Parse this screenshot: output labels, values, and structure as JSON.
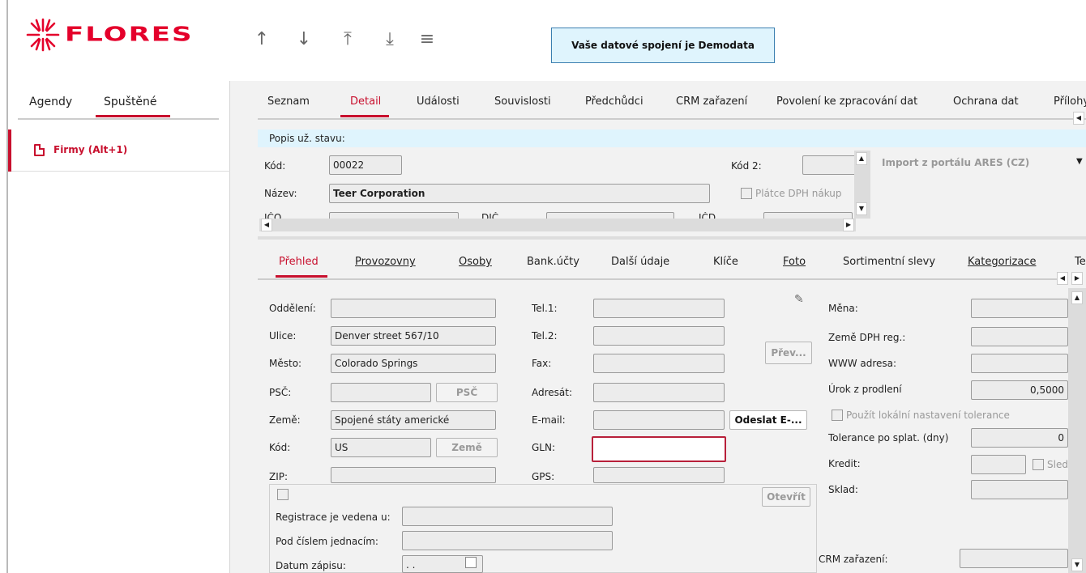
{
  "header": {
    "logo_text": "FLORES",
    "nav_icons": [
      "arrow-up-icon",
      "arrow-down-icon",
      "arrow-to-top-icon",
      "arrow-to-bottom-icon",
      "menu-icon"
    ],
    "nav_glyphs": [
      "↑",
      "↓",
      "⤒",
      "⤓",
      "≡"
    ],
    "banner": "Vaše datové spojení je Demodata"
  },
  "sidebar": {
    "tabs": [
      "Agendy",
      "Spuštěné"
    ],
    "active_tab": "Spuštěné",
    "items": [
      {
        "label": "Firmy (Alt+1)",
        "icon": "document-icon"
      }
    ]
  },
  "main": {
    "tabs": [
      "Seznam",
      "Detail",
      "Události",
      "Souvislosti",
      "Předchůdci",
      "CRM zařazení",
      "Povolení ke zpracování dat",
      "Ochrana dat",
      "Přílohy"
    ],
    "active_tab": "Detail",
    "status_label": "Popis už. stavu:",
    "kod_label": "Kód:",
    "kod_value": "00022",
    "kod2_label": "Kód 2:",
    "nazev_label": "Název:",
    "nazev_value": "Teer Corporation",
    "platce_label": "Plátce DPH nákup",
    "import_select": "Import z portálu ARES (CZ)",
    "partial_labels": [
      "IČO",
      "DIČ",
      "IČD"
    ]
  },
  "subtabs": [
    "Přehled",
    "Provozovny",
    "Osoby",
    "Bank.účty",
    "Další údaje",
    "Klíče",
    "Foto",
    "Sortimentní slevy",
    "Kategorizace",
    "Te"
  ],
  "active_subtab": "Přehled",
  "address": {
    "oddeleni_label": "Oddělení:",
    "oddeleni": "",
    "ulice_label": "Ulice:",
    "ulice": "Denver street 567/10",
    "mesto_label": "Město:",
    "mesto": "Colorado Springs",
    "psc_label": "PSČ:",
    "psc": "",
    "psc_button": "PSČ",
    "zeme_label": "Země:",
    "zeme": "Spojené státy americké",
    "kod_label": "Kód:",
    "kod": "US",
    "zeme_button": "Země",
    "zip_label": "ZIP:"
  },
  "contact": {
    "tel1_label": "Tel.1:",
    "tel2_label": "Tel.2:",
    "fax_label": "Fax:",
    "adresat_label": "Adresát:",
    "email_label": "E-mail:",
    "gln_label": "GLN:",
    "gps_label": "GPS:",
    "prev_button": "Přev...",
    "email_button": "Odeslat E-...",
    "open_button": "Otevřít"
  },
  "finance": {
    "mena_label": "Měna:",
    "zeme_dph_label": "Země DPH reg.:",
    "www_label": "WWW adresa:",
    "urok_label": "Úrok z prodlení",
    "urok_value": "0,5000",
    "tolerance_checkbox": "Použít lokální nastavení tolerance",
    "tolerance_label": "Tolerance po splat. (dny)",
    "tolerance_value": "0",
    "kredit_label": "Kredit:",
    "sled_label": "Sled",
    "sklad_label": "Sklad:",
    "crm_label": "CRM zařazení:"
  },
  "registration": {
    "reg_label": "Registrace je vedena u:",
    "pod_label": "Pod číslem jednacím:",
    "datum_label": "Datum zápisu:",
    "datum_value": ". ."
  }
}
